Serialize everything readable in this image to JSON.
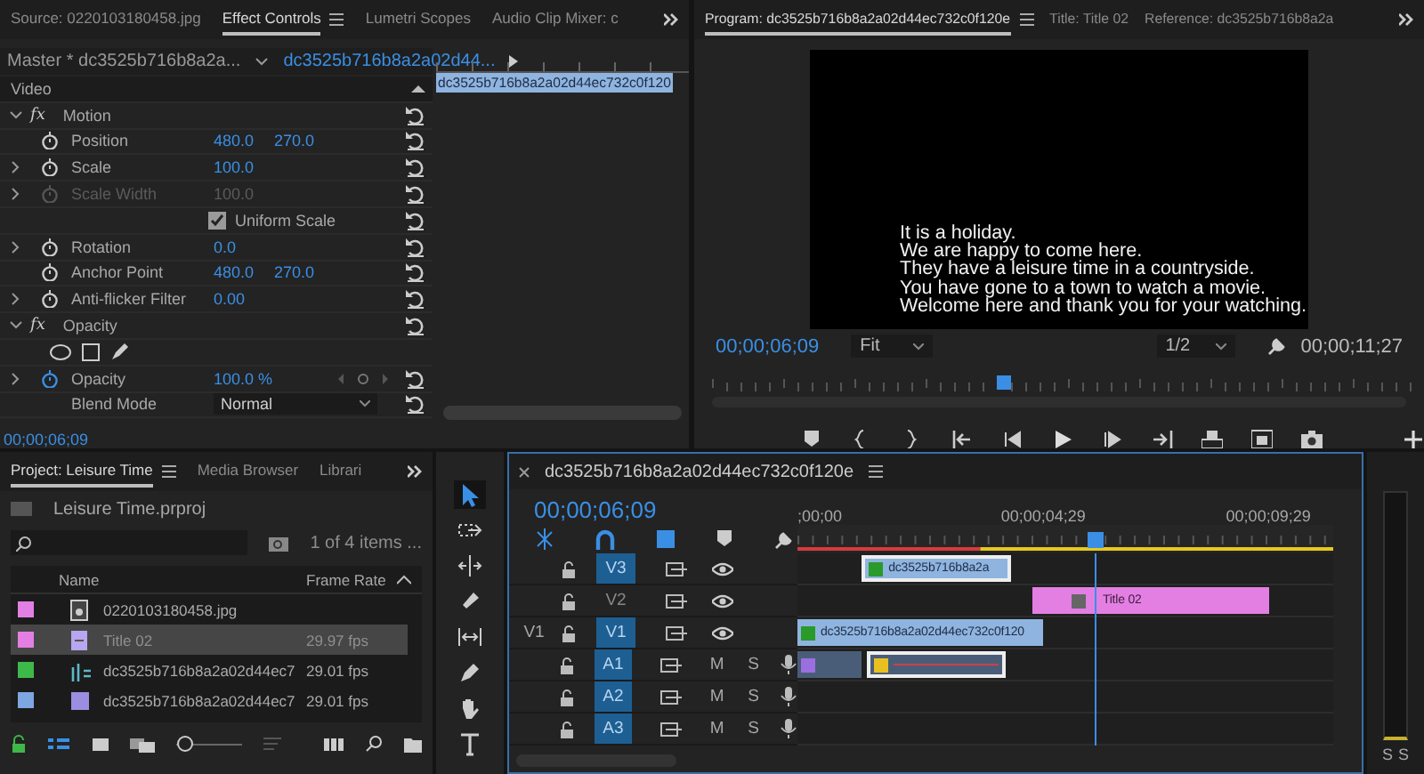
{
  "effect_controls": {
    "tabs": [
      {
        "label": "Source: 0220103180458.jpg",
        "selected": false
      },
      {
        "label": "Effect Controls",
        "selected": true
      },
      {
        "label": "Lumetri Scopes",
        "selected": false
      },
      {
        "label": "Audio Clip Mixer: c",
        "selected": false
      }
    ],
    "master": "Master * dc3525b716b8a2a...",
    "clip": "dc3525b716b8a2a02d44...",
    "rows": [
      {
        "kind": "section",
        "name": "Video"
      },
      {
        "kind": "group",
        "badge": "fx",
        "name": "Motion",
        "expanded": true
      },
      {
        "kind": "param",
        "name": "Position",
        "values": [
          "480.0",
          "270.0"
        ],
        "expandable": false,
        "disabled": false,
        "animated": false
      },
      {
        "kind": "param",
        "name": "Scale",
        "values": [
          "100.0"
        ],
        "expandable": true,
        "disabled": false,
        "animated": false
      },
      {
        "kind": "param",
        "name": "Scale Width",
        "values": [
          "100.0"
        ],
        "expandable": true,
        "disabled": true,
        "animated": false
      },
      {
        "kind": "checkbox",
        "name": "Uniform Scale",
        "checked": true
      },
      {
        "kind": "param",
        "name": "Rotation",
        "values": [
          "0.0"
        ],
        "expandable": true,
        "disabled": false,
        "animated": false
      },
      {
        "kind": "param",
        "name": "Anchor Point",
        "values": [
          "480.0",
          "270.0"
        ],
        "expandable": false,
        "disabled": false,
        "animated": false
      },
      {
        "kind": "param",
        "name": "Anti-flicker Filter",
        "values": [
          "0.00"
        ],
        "expandable": true,
        "disabled": false,
        "animated": false
      },
      {
        "kind": "group",
        "badge": "fx",
        "name": "Opacity",
        "expanded": true
      },
      {
        "kind": "masks"
      },
      {
        "kind": "param",
        "name": "Opacity",
        "values": [
          "100.0 %"
        ],
        "expandable": true,
        "disabled": false,
        "animated": true
      },
      {
        "kind": "dropdown",
        "name": "Blend Mode",
        "value": "Normal"
      }
    ],
    "timeline_clip": "dc3525b716b8a2a02d44ec732c0f120",
    "timecode": "00;00;06;09"
  },
  "program": {
    "tabs": [
      {
        "label": "Program: dc3525b716b8a2a02d44ec732c0f120e",
        "selected": true
      },
      {
        "label": "Title: Title 02",
        "selected": false
      },
      {
        "label": "Reference: dc3525b716b8a2a",
        "selected": false
      }
    ],
    "caption": [
      "It is a holiday.",
      "We are happy to come here.",
      "They have a leisure time in a countryside.",
      "You have gone to a town to watch a movie.",
      "Welcome here and thank you for your watching."
    ],
    "timecode": "00;00;06;09",
    "zoom": "Fit",
    "resolution": "1/2",
    "duration": "00;00;11;27",
    "playhead": {
      "level": 0.42
    }
  },
  "project": {
    "tabs": [
      {
        "label": "Project: Leisure Time",
        "selected": true
      },
      {
        "label": "Media Browser",
        "selected": false
      },
      {
        "label": "Librari",
        "selected": false
      }
    ],
    "file": "Leisure Time.prproj",
    "item_count": "1 of 4 items ...",
    "columns": [
      "Name",
      "Frame Rate"
    ],
    "rows": [
      {
        "kind": "image",
        "color": "#e37fe3",
        "name": "0220103180458.jpg",
        "frame_rate": "",
        "selected": false
      },
      {
        "kind": "title",
        "color": "#e37fe3",
        "name": "Title 02",
        "frame_rate": "29.97 fps",
        "selected": true
      },
      {
        "kind": "sequence",
        "color": "#3fb84a",
        "name": "dc3525b716b8a2a02d44ec7",
        "frame_rate": "29.01 fps",
        "selected": false
      },
      {
        "kind": "video",
        "color": "#7ea6e0",
        "name": "dc3525b716b8a2a02d44ec7",
        "frame_rate": "29.01 fps",
        "selected": false
      }
    ],
    "zoom_slider": {
      "level": 0
    }
  },
  "tools": [
    {
      "kind": "selection",
      "selected": true
    },
    {
      "kind": "track-select",
      "selected": false
    },
    {
      "kind": "ripple",
      "selected": false
    },
    {
      "kind": "razor",
      "selected": false
    },
    {
      "kind": "slip",
      "selected": false
    },
    {
      "kind": "pen",
      "selected": false
    },
    {
      "kind": "hand",
      "selected": false
    },
    {
      "kind": "type",
      "selected": false
    }
  ],
  "timeline": {
    "title": "dc3525b716b8a2a02d44ec732c0f120e",
    "timecode": "00;00;06;09",
    "ruler": [
      ";00;00",
      "00;00;04;29",
      "00;00;09;29"
    ],
    "playhead": {
      "level": 0.555
    },
    "tracks": [
      {
        "kind": "video",
        "name": "V3",
        "targeted": true,
        "clips": [
          {
            "kind": "video",
            "label": "dc3525b716b8a2a",
            "color": "#8fb4e0",
            "selected": true
          }
        ]
      },
      {
        "kind": "video",
        "name": "V2",
        "targeted": false,
        "clips": [
          {
            "kind": "title",
            "label": "Title 02",
            "color": "#e37fe3",
            "selected": false
          }
        ]
      },
      {
        "kind": "video",
        "name": "V1",
        "source": "V1",
        "targeted": true,
        "clips": [
          {
            "kind": "video",
            "label": "dc3525b716b8a2a02d44ec732c0f120",
            "color": "#8fb4e0",
            "selected": false
          }
        ]
      },
      {
        "kind": "audio",
        "name": "A1",
        "targeted": true,
        "mute": "M",
        "solo": "S",
        "clips": [
          {
            "kind": "audio",
            "color": "#4a5d78",
            "selected": false
          },
          {
            "kind": "audio",
            "color": "#4a5d78",
            "selected": true
          }
        ]
      },
      {
        "kind": "audio",
        "name": "A2",
        "targeted": true,
        "mute": "M",
        "solo": "S"
      },
      {
        "kind": "audio",
        "name": "A3",
        "targeted": true,
        "mute": "M",
        "solo": "S"
      }
    ]
  },
  "audio_meter": {
    "labels": [
      "S",
      "S"
    ]
  }
}
